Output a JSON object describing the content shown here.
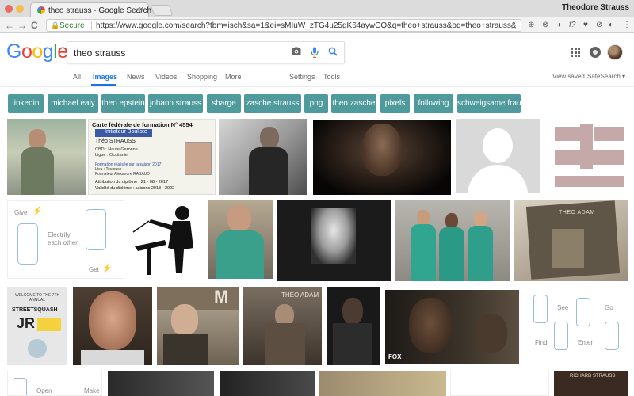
{
  "browser": {
    "tab_title": "theo strauss - Google Search",
    "tab_close": "×",
    "user_name": "Theodore Strauss",
    "secure_label": "Secure",
    "url": "https://www.google.com/search?tbm=isch&sa=1&ei=sMIuW_zTG4u25gK64aywCQ&q=theo+strauss&oq=theo+strauss&gs_l=img.3..35i39k1.1103.281...",
    "back": "←",
    "forward": "→",
    "reload": "C",
    "star": "☆",
    "extensions": [
      "⊕",
      "⊗",
      "◑",
      "f?",
      "♥",
      "⊘",
      "◐",
      "⋮"
    ]
  },
  "google": {
    "logo": [
      "G",
      "o",
      "o",
      "g",
      "l",
      "e"
    ],
    "logo_colors": [
      "#4285f4",
      "#ea4335",
      "#fbbc05",
      "#4285f4",
      "#34a853",
      "#ea4335"
    ],
    "query": "theo strauss",
    "camera_icon": "📷",
    "mic_icon": "🎤",
    "search_icon": "⚲"
  },
  "nav": {
    "tabs": [
      "All",
      "Images",
      "News",
      "Videos",
      "Shopping",
      "More"
    ],
    "active": "Images",
    "settings": "Settings",
    "tools": "Tools",
    "view_saved": "View saved",
    "safesearch": "SafeSearch ▾"
  },
  "chips": [
    "linkedin",
    "michael ealy",
    "theo epstein",
    "johann strauss",
    "sharge",
    "zasche strauss",
    "png",
    "theo zasche",
    "pixels",
    "following",
    "schweigsame frau"
  ],
  "images": {
    "captions": {
      "license_line1": "Carte fédérale de formation  N° 4554",
      "license_line2": "Initiateur Bouliste",
      "license_line3": "Théo  STRAUSS",
      "license_line4": "CBD : Haute  Garonne",
      "license_line5": "Ligue : Occitanie",
      "license_line6": "Formation réalisée sur la saison 2017",
      "license_line7": "Lieu : Toulouse",
      "license_line8": "Formateur  Alexandre  RABAUD",
      "license_line9": "Attribution du diplôme : 21 - 08 - 2017",
      "license_line10": "Validité du diplôme : saisons   2018 - 2022",
      "app_give": "Give",
      "app_electrify": "Electrify each other",
      "app_get": "Get",
      "theo_adam1": "THEO ADAM",
      "theo_adam2": "THEO ADAM",
      "fox": "FOX",
      "app_see": "See",
      "app_go": "Go",
      "app_find": "Find",
      "app_enter": "Enter",
      "welcome": "WELCOME TO THE 7TH ANNUAL",
      "streetsquash": "STREETSQUASH",
      "jr": "JR",
      "open": "Open",
      "make": "Make",
      "richard": "RICHARD STRAUSS",
      "m_letter": "M"
    }
  }
}
